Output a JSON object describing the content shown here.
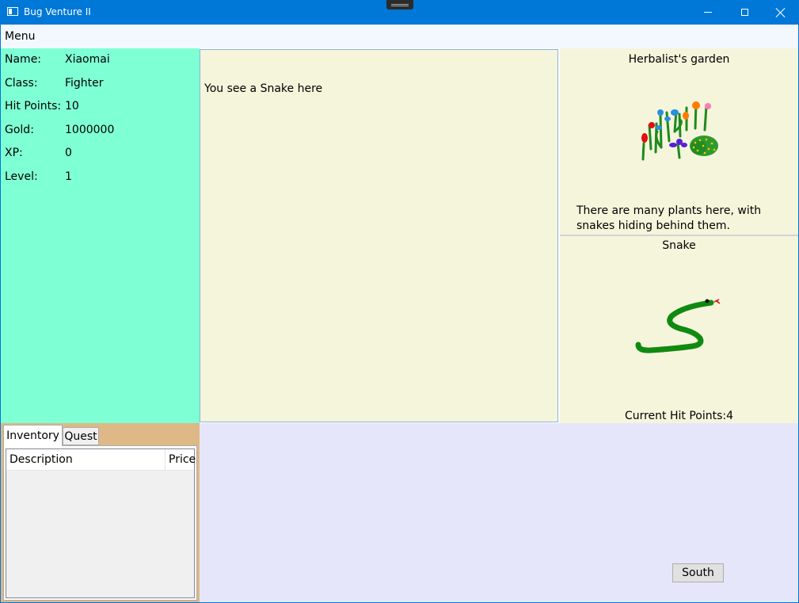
{
  "window": {
    "title": "Bug Venture II",
    "app_icon": "window-icon",
    "controls": [
      "minimize-icon",
      "maximize-icon",
      "close-icon"
    ],
    "accent_color": "#0078d7"
  },
  "menu": {
    "items": [
      {
        "label": "Menu"
      }
    ]
  },
  "player": {
    "background_color": "#7fffd4",
    "stats": [
      {
        "label": "Name:",
        "value": "Xiaomai"
      },
      {
        "label": "Class:",
        "value": "Fighter"
      },
      {
        "label": "Hit Points:",
        "value": "10"
      },
      {
        "label": "Gold:",
        "value": "1000000"
      },
      {
        "label": "XP:",
        "value": "0"
      },
      {
        "label": "Level:",
        "value": "1"
      }
    ]
  },
  "messages": {
    "background_color": "#f5f5dc",
    "lines": [
      "You see a Snake here"
    ]
  },
  "location": {
    "name": "Herbalist's garden",
    "image": "garden-plants-image",
    "description": "There are many plants here, with snakes hiding behind them."
  },
  "monster": {
    "name": "Snake",
    "image": "snake-image",
    "hp_label": "Current Hit Points:",
    "hp_value": "4"
  },
  "tabs": {
    "background_color": "#deb887",
    "items": [
      {
        "label": "Inventory",
        "selected": true
      },
      {
        "label": "Quest",
        "selected": false
      }
    ],
    "inventory_columns": [
      "Description",
      "Price"
    ]
  },
  "actions": {
    "background_color": "#e6e6fa",
    "buttons": [
      {
        "label": "South"
      }
    ]
  }
}
